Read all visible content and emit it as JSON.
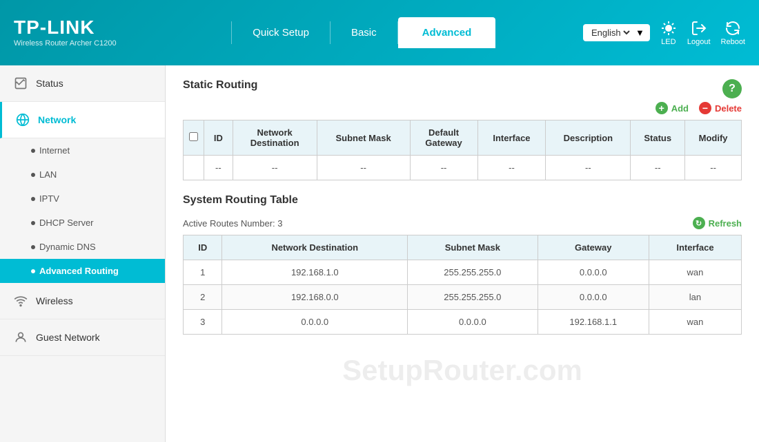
{
  "header": {
    "logo": "TP-LINK",
    "subtitle": "Wireless Router Archer C1200",
    "nav": [
      {
        "id": "quick-setup",
        "label": "Quick Setup"
      },
      {
        "id": "basic",
        "label": "Basic"
      },
      {
        "id": "advanced",
        "label": "Advanced",
        "active": true
      }
    ],
    "language": "English",
    "icons": [
      {
        "id": "led",
        "label": "LED"
      },
      {
        "id": "logout",
        "label": "Logout"
      },
      {
        "id": "reboot",
        "label": "Reboot"
      }
    ]
  },
  "sidebar": {
    "items": [
      {
        "id": "status",
        "label": "Status",
        "icon": "status-icon"
      },
      {
        "id": "network",
        "label": "Network",
        "icon": "network-icon",
        "active": true,
        "sub": [
          {
            "id": "internet",
            "label": "Internet"
          },
          {
            "id": "lan",
            "label": "LAN"
          },
          {
            "id": "iptv",
            "label": "IPTV"
          },
          {
            "id": "dhcp-server",
            "label": "DHCP Server"
          },
          {
            "id": "dynamic-dns",
            "label": "Dynamic DNS"
          },
          {
            "id": "advanced-routing",
            "label": "Advanced Routing",
            "active": true
          }
        ]
      },
      {
        "id": "wireless",
        "label": "Wireless",
        "icon": "wireless-icon"
      },
      {
        "id": "guest-network",
        "label": "Guest Network",
        "icon": "guest-icon"
      }
    ]
  },
  "content": {
    "static_routing": {
      "title": "Static Routing",
      "add_label": "Add",
      "delete_label": "Delete",
      "table": {
        "headers": [
          "",
          "ID",
          "Network Destination",
          "Subnet Mask",
          "Default Gateway",
          "Interface",
          "Description",
          "Status",
          "Modify"
        ],
        "rows": [
          [
            "",
            "--",
            "--",
            "--",
            "--",
            "--",
            "--",
            "--",
            "--"
          ]
        ]
      }
    },
    "system_routing": {
      "title": "System Routing Table",
      "active_routes_label": "Active Routes Number:",
      "active_routes_value": "3",
      "refresh_label": "Refresh",
      "table": {
        "headers": [
          "ID",
          "Network Destination",
          "Subnet Mask",
          "Gateway",
          "Interface"
        ],
        "rows": [
          [
            "1",
            "192.168.1.0",
            "255.255.255.0",
            "0.0.0.0",
            "wan"
          ],
          [
            "2",
            "192.168.0.0",
            "255.255.255.0",
            "0.0.0.0",
            "lan"
          ],
          [
            "3",
            "0.0.0.0",
            "0.0.0.0",
            "192.168.1.1",
            "wan"
          ]
        ]
      }
    },
    "watermark": "SetupRouter.com"
  }
}
